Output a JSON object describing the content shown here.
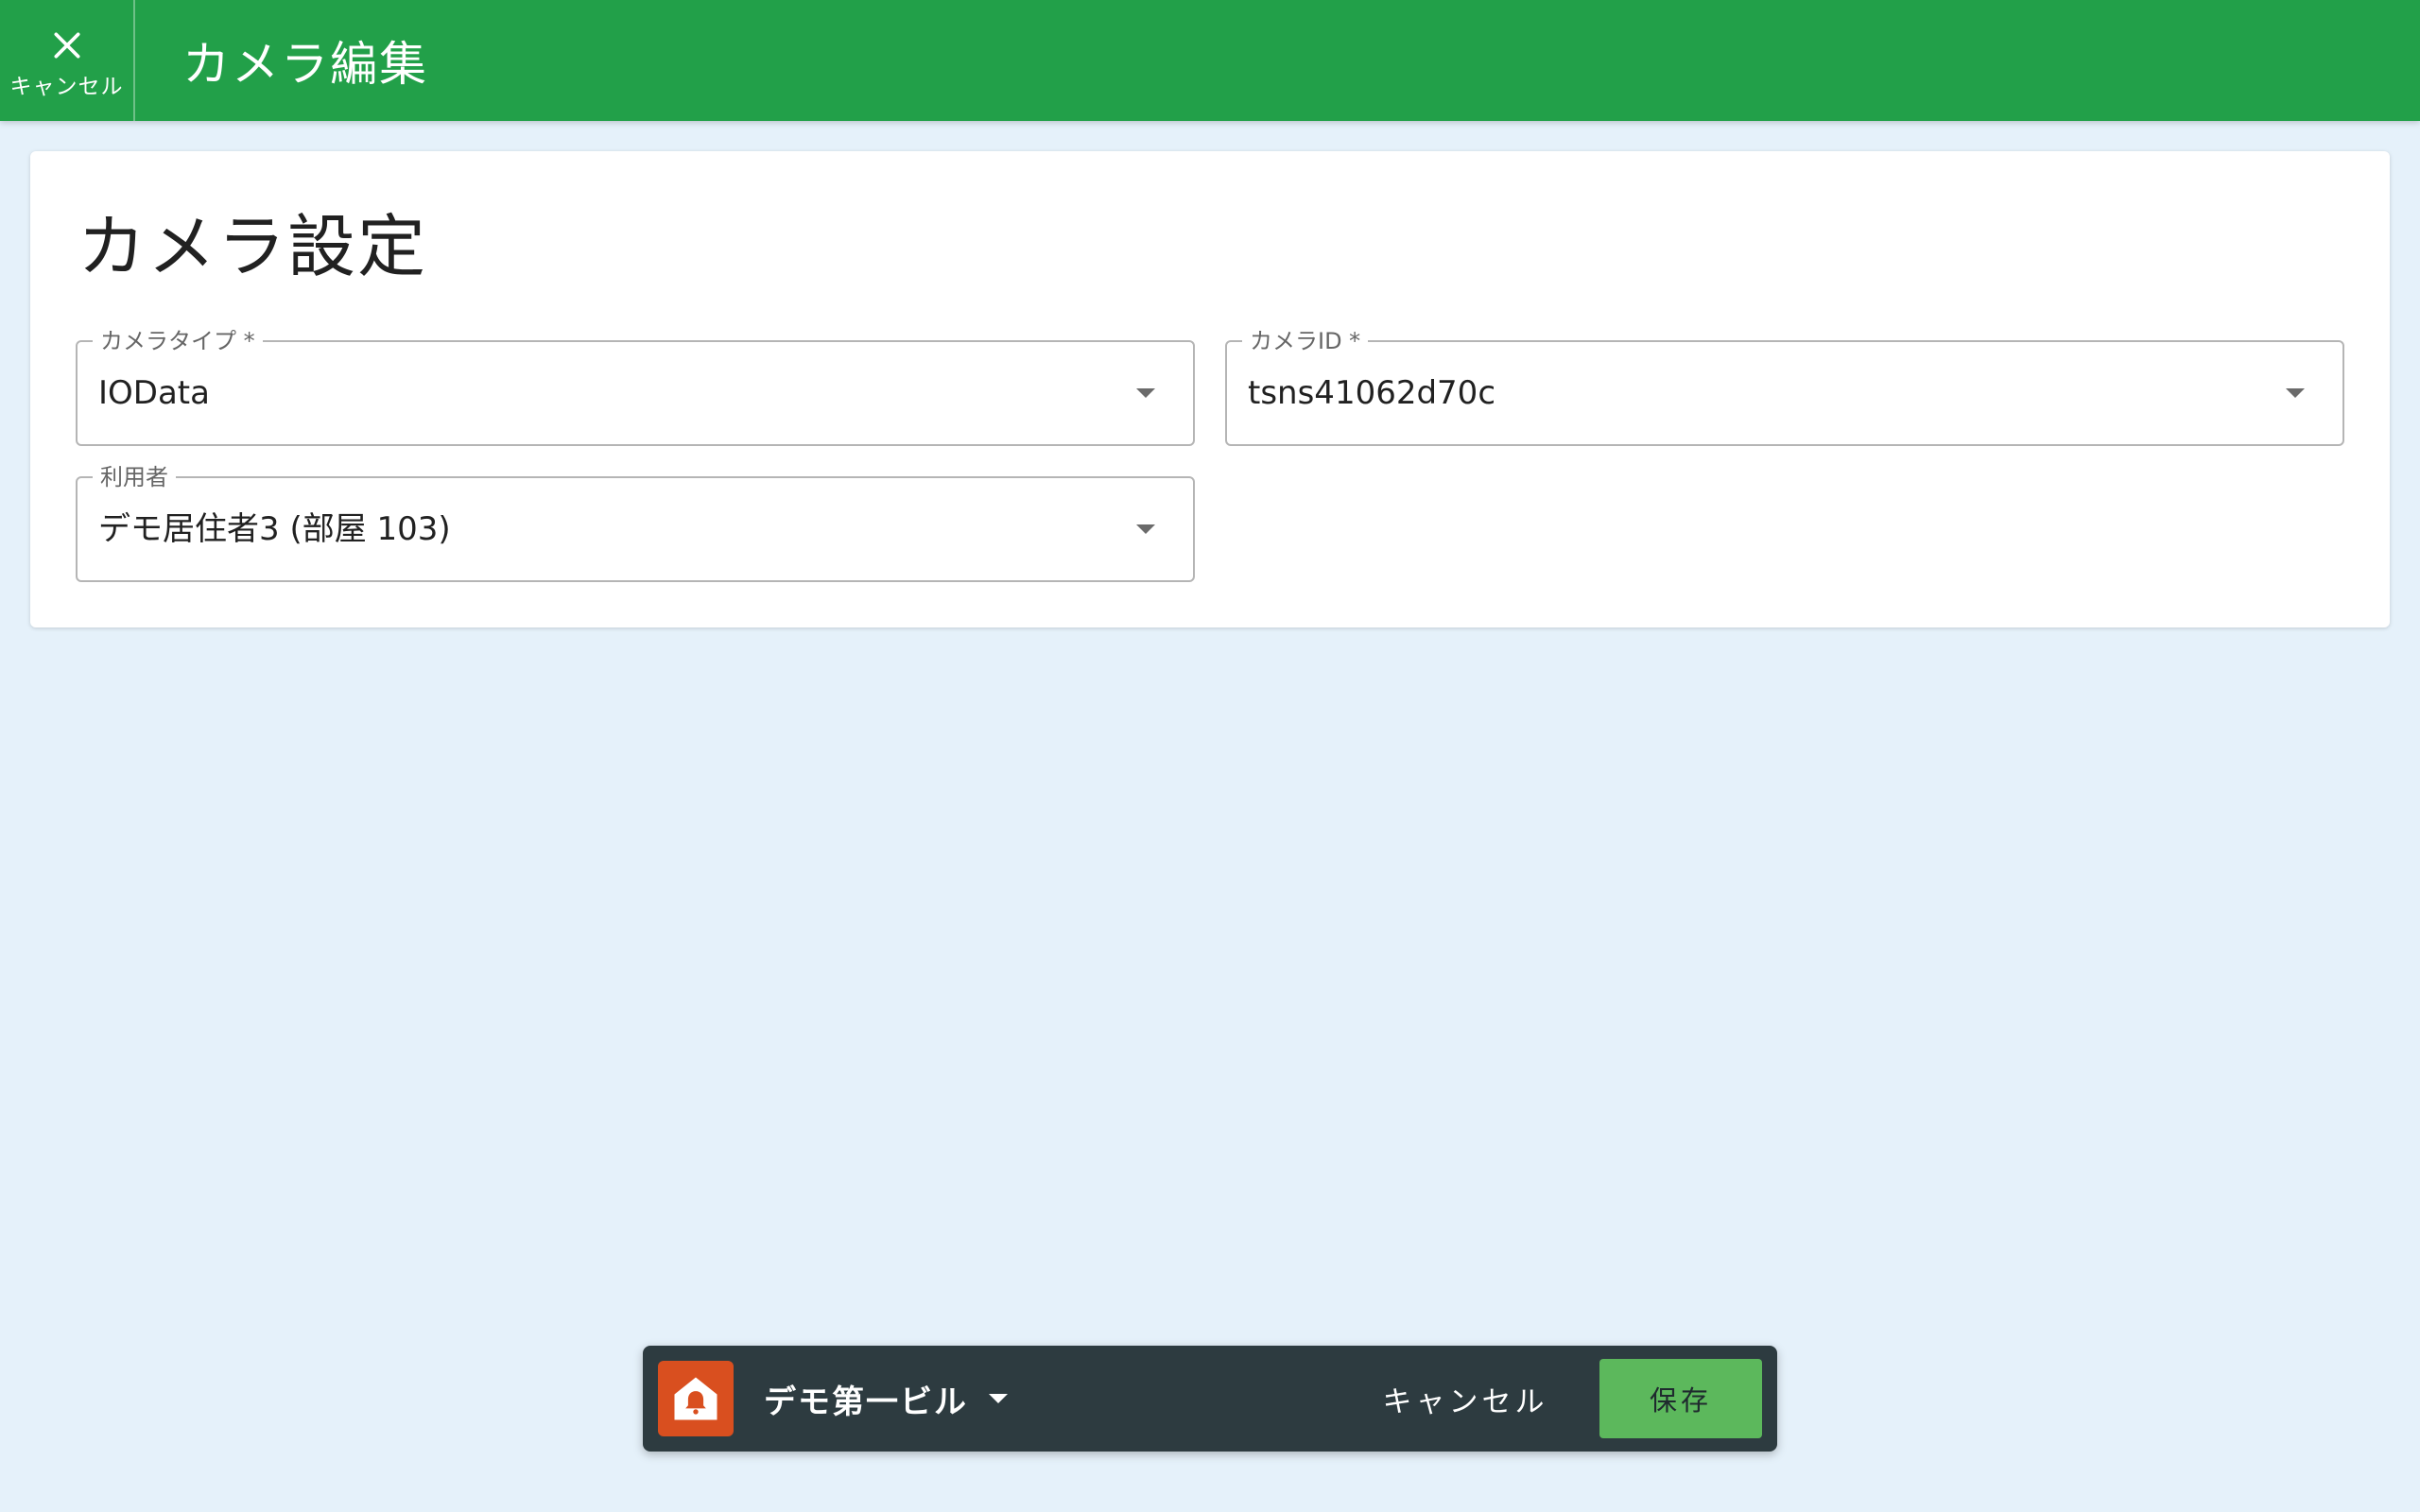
{
  "header": {
    "cancel_label": "キャンセル",
    "title": "カメラ編集",
    "color": "#22a049"
  },
  "card": {
    "title": "カメラ設定",
    "fields": {
      "camera_type": {
        "label": "カメラタイプ *",
        "value": "IOData"
      },
      "camera_id": {
        "label": "カメラID *",
        "value": "tsns41062d70c"
      },
      "user": {
        "label": "利用者",
        "value": "デモ居住者3 (部屋 103)"
      }
    }
  },
  "footer": {
    "building": "デモ第一ビル",
    "cancel_label": "キャンセル",
    "save_label": "保存",
    "save_color": "#5cb85c",
    "bar_color": "#2d3b40",
    "logo_color": "#d94f1f",
    "logo_icon": "house-bell-icon"
  }
}
